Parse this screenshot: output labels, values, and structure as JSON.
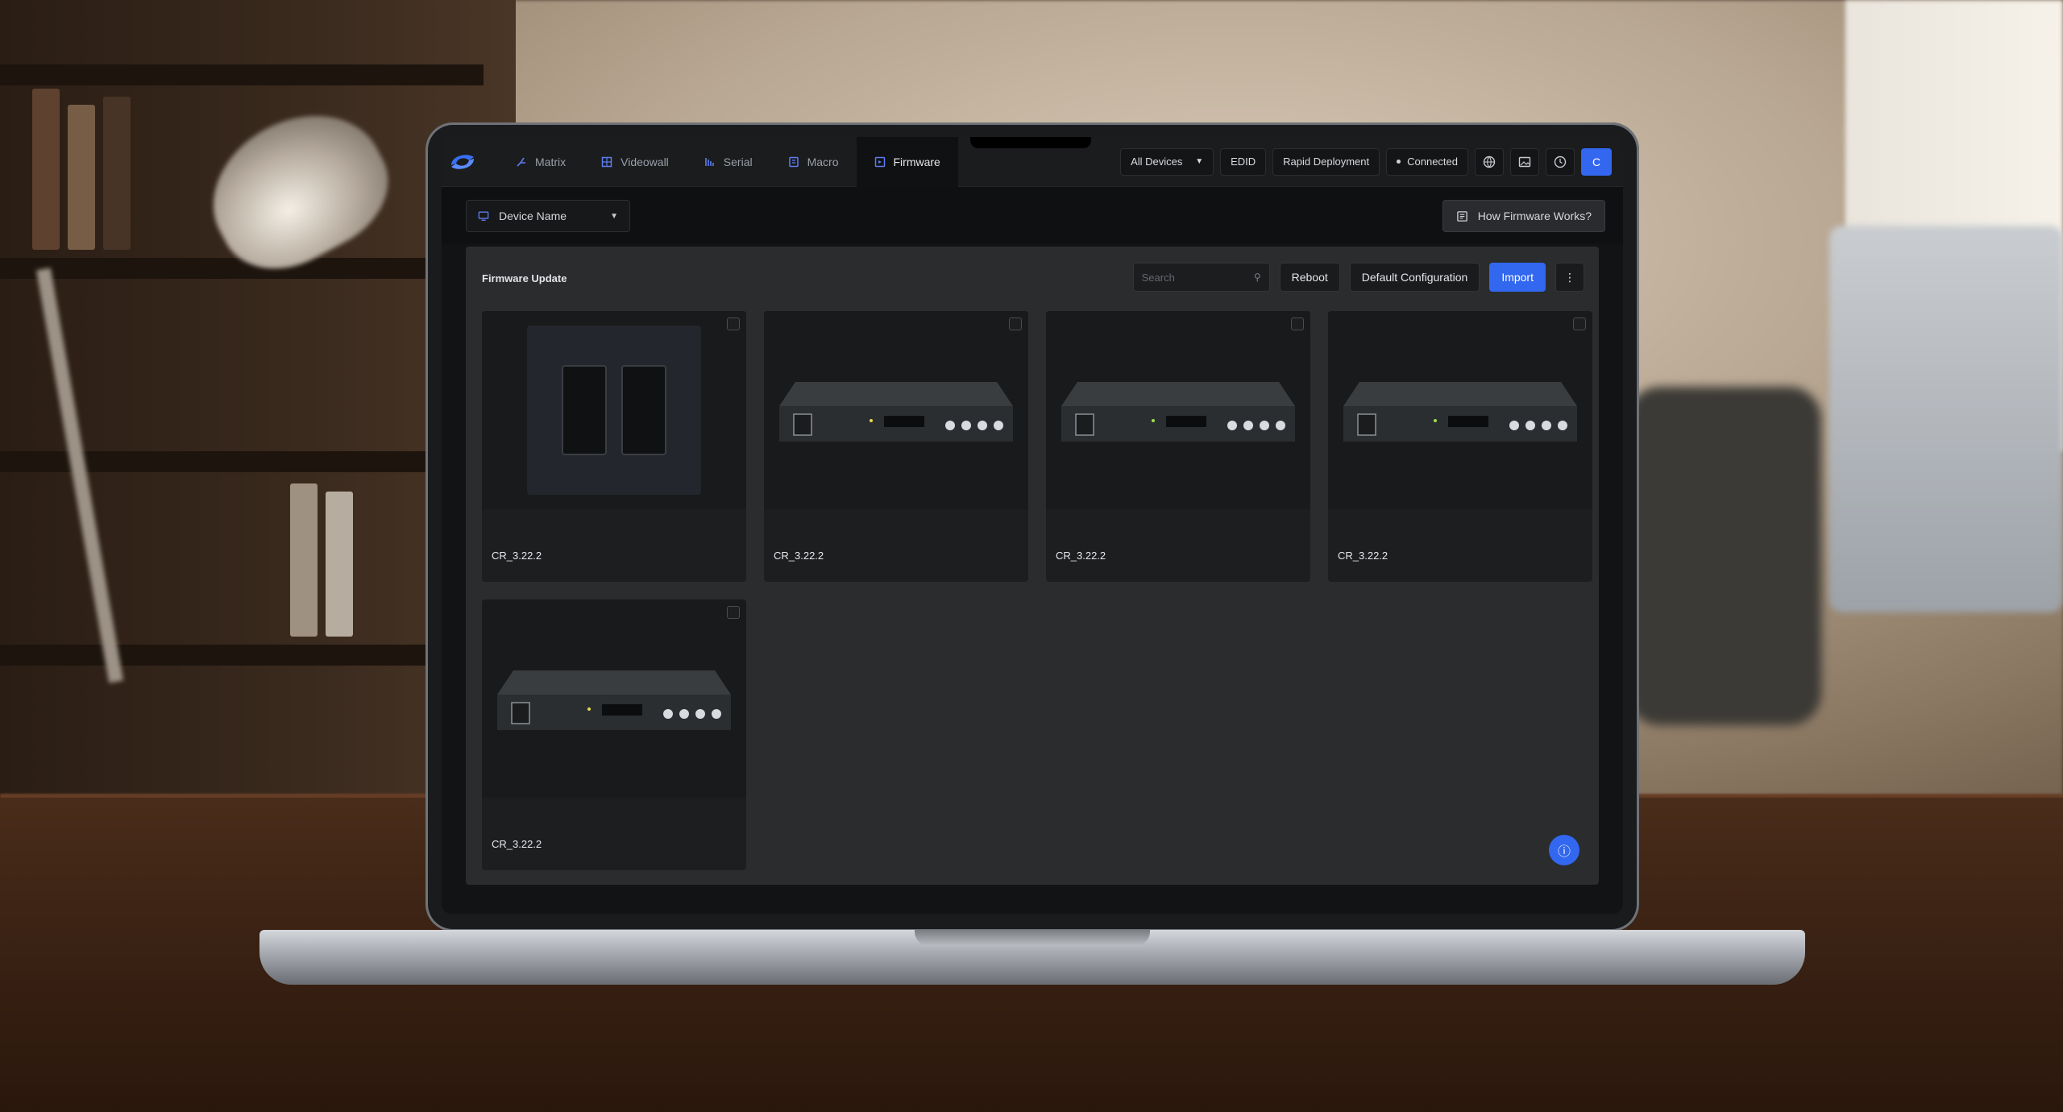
{
  "app": {
    "tabs": [
      {
        "label": "Matrix",
        "icon": "matrix-icon",
        "active": false
      },
      {
        "label": "Videowall",
        "icon": "videowall-icon",
        "active": false
      },
      {
        "label": "Serial",
        "icon": "serial-icon",
        "active": false
      },
      {
        "label": "Macro",
        "icon": "macro-icon",
        "active": false
      },
      {
        "label": "Firmware",
        "icon": "firmware-icon",
        "active": true
      }
    ],
    "toolbar": {
      "devices_dropdown": "All Devices",
      "edid_label": "EDID",
      "deployment_label": "Rapid Deployment",
      "connected_label": "Connected",
      "avatar_initial": "C"
    },
    "device_select": "Device Name",
    "how_firmware_works": "How Firmware Works?",
    "panel": {
      "title": "Firmware Update",
      "search_placeholder": "Search",
      "reboot_label": "Reboot",
      "default_config_label": "Default Configuration",
      "import_label": "Import"
    },
    "devices": [
      {
        "kind": "wallplate",
        "firmware": "CR_3.22.2"
      },
      {
        "kind": "rack",
        "firmware": "CR_3.22.2"
      },
      {
        "kind": "rack",
        "firmware": "CR_3.22.2"
      },
      {
        "kind": "rack",
        "firmware": "CR_3.22.2"
      },
      {
        "kind": "rack",
        "firmware": "CR_3.22.2"
      }
    ]
  },
  "colors": {
    "accent": "#3267ef",
    "background": "#121314",
    "panel": "#2b2c2e",
    "card": "#1d1e20"
  }
}
